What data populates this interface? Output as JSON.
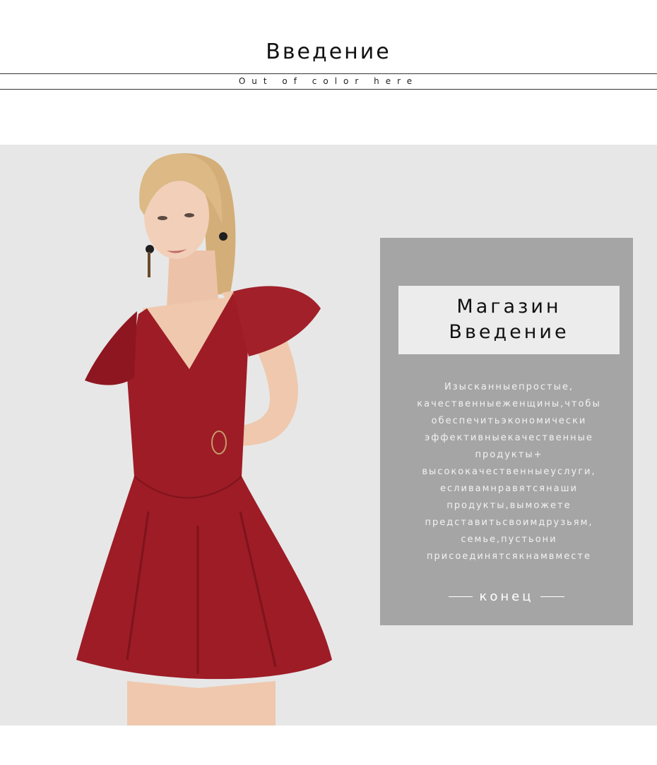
{
  "header": {
    "title": "Введение",
    "subtitle": "Out of color here"
  },
  "panel": {
    "title_line1": "Магазин",
    "title_line2": "Введение",
    "description_lines": [
      "Изысканныепростые,",
      "качественныеженщины,чтобы",
      "обеспечитьэкономически",
      "эффективныекачественные",
      "продукты+",
      "высококачественныеуслуги,",
      "есливамнравятсянаши",
      "продукты,выможете",
      "представитьсвоимдрузьям,",
      "семье,пустьони",
      "присоединятсякнамвместе"
    ],
    "end_label": "конец"
  },
  "colors": {
    "background": "#e7e7e7",
    "panel": "#a5a5a5",
    "title_box": "#ececec",
    "dress": "#9b1b24",
    "hair": "#d9b683",
    "skin": "#f1cdb5"
  }
}
